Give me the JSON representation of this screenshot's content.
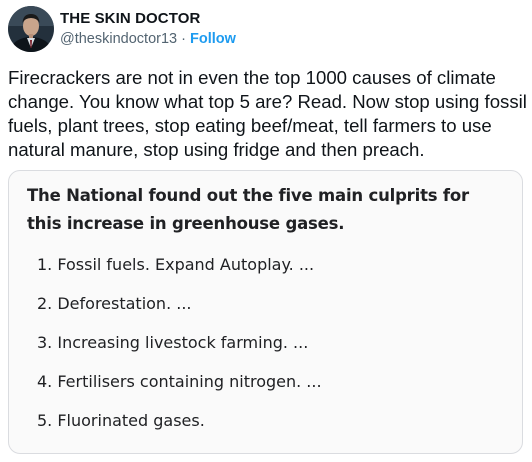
{
  "author": {
    "display_name": "THE SKIN DOCTOR",
    "handle": "@theskindoctor13",
    "separator": " · ",
    "follow_label": "Follow"
  },
  "tweet": {
    "text": "Firecrackers are not in even the top 1000 causes of climate change. You know what top 5 are? Read. Now stop using fossil fuels, plant trees, stop eating beef/meat, tell farmers to use natural manure, stop using fridge and then preach."
  },
  "card": {
    "heading": "The National found out the five main culprits for this increase in greenhouse gases.",
    "items": [
      "1. Fossil fuels. Expand Autoplay. ...",
      "2. Deforestation. ...",
      "3. Increasing livestock farming. ...",
      "4. Fertilisers containing nitrogen. ...",
      "5. Fluorinated gases."
    ]
  },
  "colors": {
    "text": "#0f1419",
    "secondary": "#536471",
    "follow": "#1d9bf0",
    "card_bg": "#fafafa",
    "card_border": "#dadce0"
  },
  "icons": {
    "avatar": "profile-photo"
  }
}
